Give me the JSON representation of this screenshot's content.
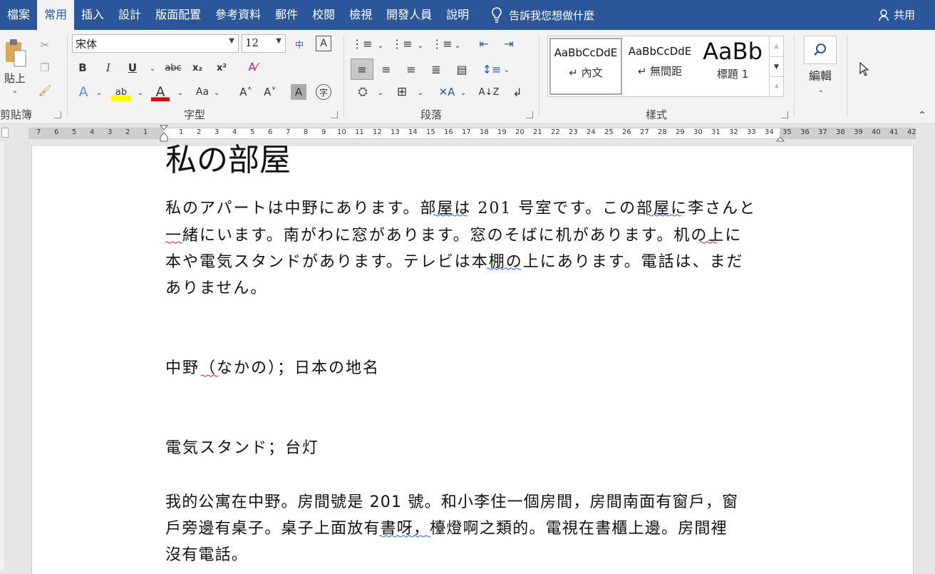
{
  "tabs": [
    {
      "label": "檔案"
    },
    {
      "label": "常用"
    },
    {
      "label": "插入"
    },
    {
      "label": "設計"
    },
    {
      "label": "版面配置"
    },
    {
      "label": "參考資料"
    },
    {
      "label": "郵件"
    },
    {
      "label": "校閱"
    },
    {
      "label": "檢視"
    },
    {
      "label": "開發人員"
    },
    {
      "label": "說明"
    }
  ],
  "tell_me": "告訴我您想做什麼",
  "share": "共用",
  "clipboard": {
    "paste": "貼上",
    "group": "剪貼簿"
  },
  "font": {
    "name": "宋体",
    "size": "12",
    "group": "字型"
  },
  "paragraph": {
    "group": "段落"
  },
  "styles": {
    "group": "樣式",
    "items": [
      {
        "sample": "AaBbCcDdE",
        "name": "↵ 內文"
      },
      {
        "sample": "AaBbCcDdE",
        "name": "↵ 無間距"
      },
      {
        "sample": "AaBb",
        "name": "標題 1"
      }
    ]
  },
  "editing": {
    "label": "編輯"
  },
  "ruler": {
    "left": [
      "7",
      "6",
      "5",
      "4",
      "3",
      "2",
      "1"
    ],
    "right": [
      "1",
      "2",
      "3",
      "4",
      "5",
      "6",
      "7",
      "8",
      "9",
      "10",
      "11",
      "12",
      "13",
      "14",
      "15",
      "16",
      "17",
      "18",
      "19",
      "20",
      "21",
      "22",
      "23",
      "24",
      "25",
      "26",
      "27",
      "28",
      "29",
      "30",
      "31",
      "32",
      "33",
      "34",
      "35",
      "36",
      "37",
      "38",
      "39",
      "40",
      "41",
      "42"
    ]
  },
  "document": {
    "title": "私の部屋",
    "para1": [
      "私のアパートは中野にあります。部屋は 201 号室です。この部屋に李さんと",
      "一緒にいます。南がわに窓があります。窓のそばに机があります。机の上に",
      "本や電気スタンドがあります。テレビは本棚の上にあります。電話は、まだ",
      "ありません。"
    ],
    "note1": "中野（なかの）；日本の地名",
    "note2": "電気スタンド；台灯",
    "para2": [
      "我的公寓在中野。房間號是 201 號。和小李住一個房間，房間南面有窗戶，窗",
      "戶旁邊有桌子。桌子上面放有書呀，檯燈啊之類的。電視在書櫃上邊。房間裡",
      "沒有電話。"
    ]
  }
}
